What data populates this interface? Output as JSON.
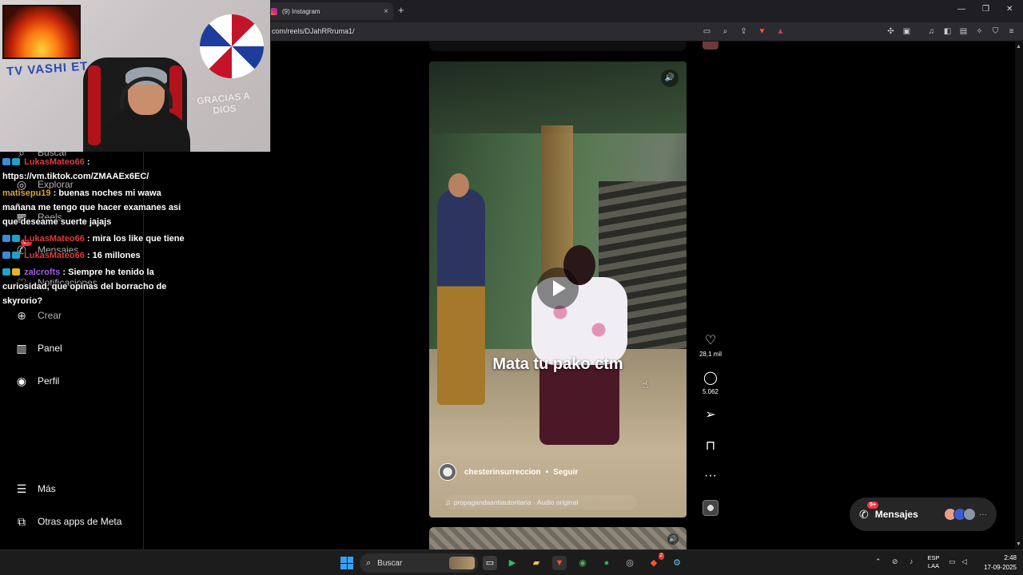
{
  "browser": {
    "tab_title": "(9) Instagram",
    "url": "com/reels/DJahRRruma1/",
    "tab_close": "×",
    "new_tab": "+",
    "minimize": "—",
    "maximize": "❐",
    "close": "✕"
  },
  "stream": {
    "banner_text": "TV VASHI ET",
    "wall_text": "GRACIAS A DIOS"
  },
  "sidebar": {
    "items": [
      {
        "label": "Buscar",
        "icon": "search-icon"
      },
      {
        "label": "Explorar",
        "icon": "compass-icon"
      },
      {
        "label": "Reels",
        "icon": "reels-icon"
      },
      {
        "label": "Mensajes",
        "icon": "messenger-icon",
        "badge": "9+"
      },
      {
        "label": "Notificaciones",
        "icon": "heart-icon"
      },
      {
        "label": "Crear",
        "icon": "plus-icon"
      },
      {
        "label": "Panel",
        "icon": "dashboard-icon"
      },
      {
        "label": "Perfil",
        "icon": "avatar-icon"
      },
      {
        "label": "Más",
        "icon": "menu-icon"
      },
      {
        "label": "Otras apps de Meta",
        "icon": "meta-apps-icon"
      }
    ]
  },
  "chat": {
    "messages": [
      {
        "user": "LukasMateo66",
        "sep": " :",
        "text": "https://vm.tiktok.com/ZMAAEx6EC/"
      },
      {
        "user": "matisepu19",
        "sep": " :",
        "text": " buenas noches mi wawa mañana me tengo que hacer examanes asi que deseame suerte jajajs"
      },
      {
        "user": "LukasMateo66",
        "sep": " :",
        "text": " mira los like que tiene"
      },
      {
        "user": "LukasMateo66",
        "sep": " :",
        "text": " 16 millones"
      },
      {
        "user": "zalcrofts",
        "sep": " :",
        "text": " Siempre he tenido la curiosidad, que opinas del borracho de skyrorio?"
      }
    ]
  },
  "reel": {
    "caption": "Mata tu pako ctm",
    "author": "chesterinsurreccion",
    "separator": "•",
    "follow": "Seguir",
    "audio": "propagandaantiautoritaria · Audio original",
    "mute_icon": "🔊",
    "note_icon": "♫"
  },
  "actions": {
    "likes": "28,1 mil",
    "comments": "5.062",
    "like_icon": "♡",
    "comment_icon": "◯",
    "share_icon": "➢",
    "save_icon": "⊓",
    "more_icon": "···"
  },
  "messages_pill": {
    "label": "Mensajes",
    "badge": "9+",
    "more": "···"
  },
  "taskbar": {
    "search_label": "Buscar",
    "lang_line1": "ESP",
    "lang_line2": "LAA",
    "time": "2:48",
    "date": "17-09-2025",
    "badge": "2"
  }
}
